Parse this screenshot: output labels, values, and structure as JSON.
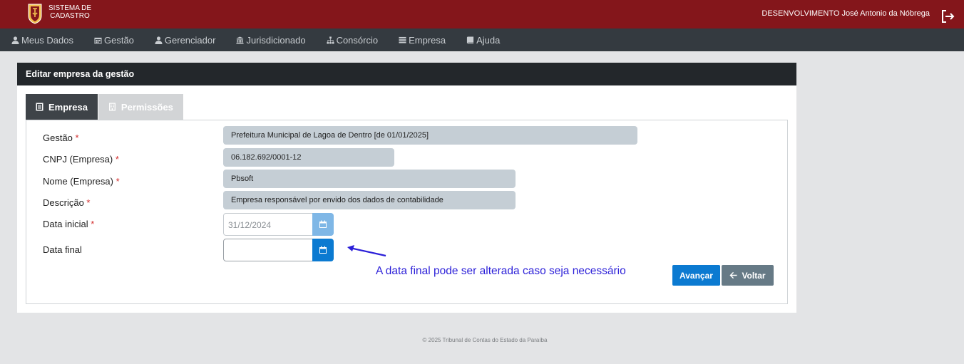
{
  "header": {
    "brand_line1": "SISTEMA DE",
    "brand_line2": "CADASTRO",
    "user": "DESENVOLVIMENTO José Antonio da Nóbrega"
  },
  "nav": [
    {
      "label": "Meus Dados",
      "icon": "user-icon"
    },
    {
      "label": "Gestão",
      "icon": "calendar-icon"
    },
    {
      "label": "Gerenciador",
      "icon": "user-icon"
    },
    {
      "label": "Jurisdicionado",
      "icon": "institution-icon"
    },
    {
      "label": "Consórcio",
      "icon": "sitemap-icon"
    },
    {
      "label": "Empresa",
      "icon": "list-icon"
    },
    {
      "label": "Ajuda",
      "icon": "book-icon"
    }
  ],
  "card": {
    "title": "Editar empresa da gestão"
  },
  "tabs": [
    {
      "label": "Empresa",
      "active": true
    },
    {
      "label": "Permissões",
      "active": false
    }
  ],
  "form": {
    "gestao_label": "Gestão",
    "gestao_value": "Prefeitura Municipal de Lagoa de Dentro [de 01/01/2025]",
    "cnpj_label": "CNPJ (Empresa)",
    "cnpj_value": "06.182.692/0001-12",
    "nome_label": "Nome (Empresa)",
    "nome_value": "Pbsoft",
    "descricao_label": "Descrição",
    "descricao_value": "Empresa responsável por envido dos dados de contabilidade",
    "data_inicial_label": "Data inicial",
    "data_inicial_value": "31/12/2024",
    "data_final_label": "Data final",
    "data_final_value": "",
    "required_mark": "*"
  },
  "annotation": "A data final pode ser alterada caso seja necessário",
  "buttons": {
    "advance": "Avançar",
    "back": "Voltar"
  },
  "footer": "© 2025 Tribunal de Contas do Estado da Paraíba",
  "colors": {
    "header_bg": "#84161b",
    "nav_bg": "#343a40",
    "primary": "#0b7ad1",
    "secondary": "#667a86",
    "annotation": "#2b1fd8"
  }
}
